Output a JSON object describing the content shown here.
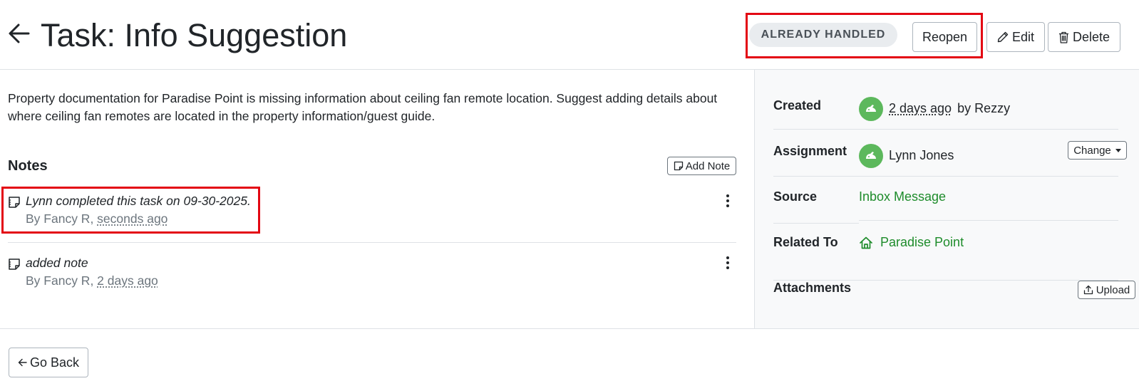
{
  "header": {
    "title": "Task: Info Suggestion",
    "status_badge": "ALREADY HANDLED",
    "reopen_label": "Reopen",
    "edit_label": "Edit",
    "delete_label": "Delete"
  },
  "main": {
    "description": "Property documentation for Paradise Point is missing information about ceiling fan remote location. Suggest adding details about where ceiling fan remotes are located in the property information/guest guide.",
    "notes_heading": "Notes",
    "add_note_label": "Add Note",
    "notes": [
      {
        "text": "Lynn completed this task on 09-30-2025.",
        "by": "By Fancy R, ",
        "time": "seconds ago"
      },
      {
        "text": "added note",
        "by": "By Fancy R, ",
        "time": "2 days ago"
      }
    ]
  },
  "sidebar": {
    "created_label": "Created",
    "created_time": "2 days ago",
    "created_by": "by Rezzy",
    "assignment_label": "Assignment",
    "assignee": "Lynn Jones",
    "change_label": "Change",
    "source_label": "Source",
    "source_value": "Inbox Message",
    "related_label": "Related To",
    "related_value": "Paradise Point",
    "attachments_label": "Attachments",
    "upload_label": "Upload"
  },
  "footer": {
    "go_back_label": "Go Back"
  },
  "colors": {
    "accent_green": "#1e8c2b",
    "avatar_green": "#5cb85c",
    "highlight_red": "#e30613",
    "badge_bg": "#e9ecef"
  },
  "icons": [
    "back-arrow-icon",
    "pencil-icon",
    "trash-icon",
    "note-icon",
    "kebab-icon",
    "avatar-icon",
    "home-icon",
    "caret-down-icon",
    "upload-icon"
  ]
}
